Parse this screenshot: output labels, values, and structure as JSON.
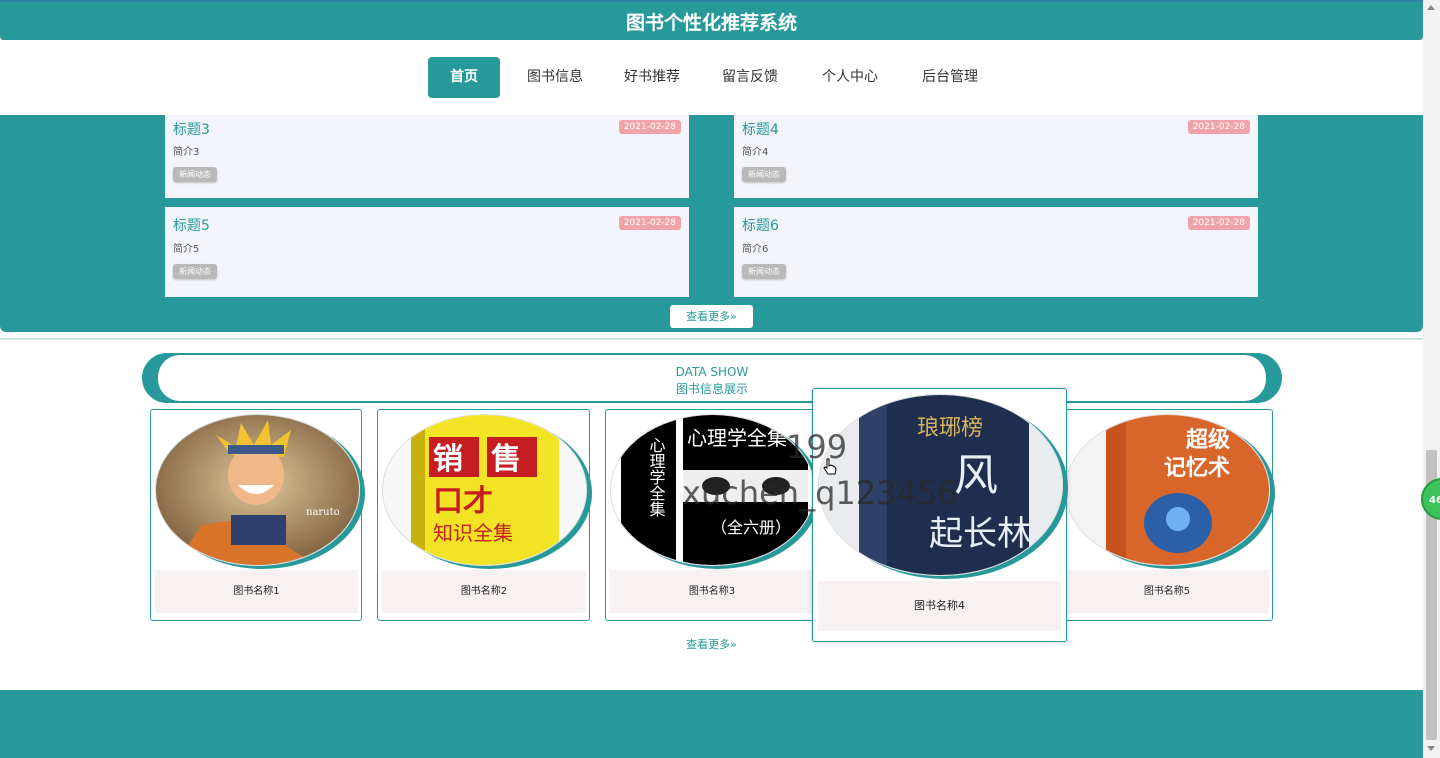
{
  "header": {
    "title": "图书个性化推荐系统"
  },
  "nav": {
    "items": [
      {
        "label": "首页"
      },
      {
        "label": "图书信息"
      },
      {
        "label": "好书推荐"
      },
      {
        "label": "留言反馈"
      },
      {
        "label": "个人中心"
      },
      {
        "label": "后台管理"
      }
    ],
    "active_index": 0
  },
  "news": {
    "items": [
      {
        "title": "标题3",
        "desc": "简介3",
        "tag": "新闻动态",
        "date": "2021-02-28"
      },
      {
        "title": "标题4",
        "desc": "简介4",
        "tag": "新闻动态",
        "date": "2021-02-28"
      },
      {
        "title": "标题5",
        "desc": "简介5",
        "tag": "新闻动态",
        "date": "2021-02-28"
      },
      {
        "title": "标题6",
        "desc": "简介6",
        "tag": "新闻动态",
        "date": "2021-02-28"
      }
    ],
    "more_label": "查看更多»"
  },
  "data_show": {
    "title_en": "DATA SHOW",
    "title_cn": "图书信息展示",
    "books": [
      {
        "name": "图书名称1",
        "cover_text": "NARUTO"
      },
      {
        "name": "图书名称2",
        "cover_text": "销售与口才 知识全集"
      },
      {
        "name": "图书名称3",
        "cover_text": "心理学全集（全六册）"
      },
      {
        "name": "图书名称4",
        "cover_text": "琅琊榜之风起长林"
      },
      {
        "name": "图书名称5",
        "cover_text": "超级记忆术"
      }
    ],
    "more_label": "查看更多»"
  },
  "overlay": {
    "line1": "199",
    "line2": "xuchen_q123456"
  },
  "widget": {
    "badge": "46"
  },
  "colors": {
    "primary": "#28999a",
    "date_badge": "#f0a3a9",
    "card_bg": "#f3f5fa"
  }
}
